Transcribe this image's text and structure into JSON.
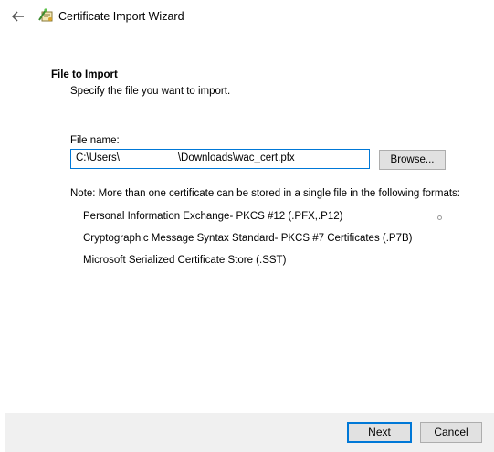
{
  "window": {
    "title": "Certificate Import Wizard"
  },
  "section": {
    "heading": "File to Import",
    "subheading": "Specify the file you want to import."
  },
  "file": {
    "label": "File name:",
    "value": "C:\\Users\\                    \\Downloads\\wac_cert.pfx",
    "browse_label": "Browse..."
  },
  "note": "Note:  More than one certificate can be stored in a single file in the following formats:",
  "formats": [
    "Personal Information Exchange- PKCS #12 (.PFX,.P12)",
    "Cryptographic Message Syntax Standard- PKCS #7 Certificates (.P7B)",
    "Microsoft Serialized Certificate Store (.SST)"
  ],
  "buttons": {
    "next": "Next",
    "cancel": "Cancel"
  },
  "icons": {
    "back": "back-arrow-icon",
    "wizard": "certificate-wizard-icon"
  },
  "colors": {
    "accent": "#0078d7",
    "footer_bg": "#f0f0f0",
    "button_bg": "#e1e1e1"
  }
}
